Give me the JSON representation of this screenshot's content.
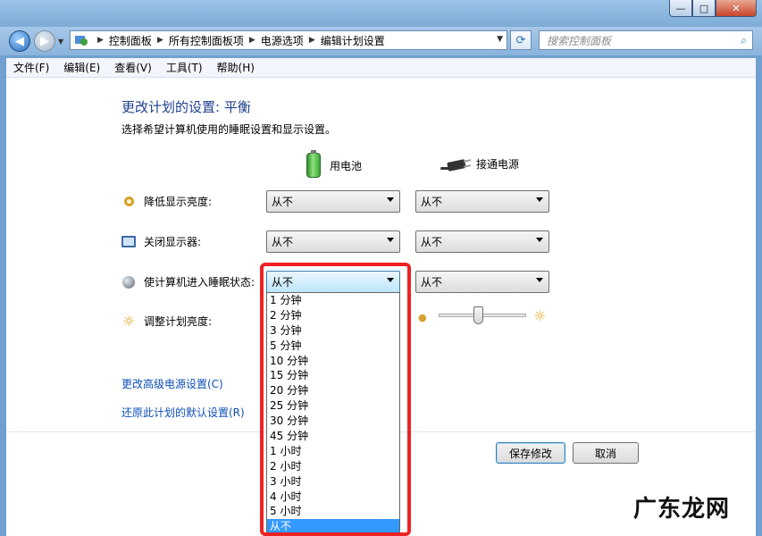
{
  "window": {
    "minimize_glyph": "—",
    "maximize_glyph": "□",
    "close_glyph": "✕"
  },
  "nav": {
    "breadcrumbs": [
      "控制面板",
      "所有控制面板项",
      "电源选项",
      "编辑计划设置"
    ],
    "search_placeholder": "搜索控制面板"
  },
  "menu": [
    "文件(F)",
    "编辑(E)",
    "查看(V)",
    "工具(T)",
    "帮助(H)"
  ],
  "page": {
    "title": "更改计划的设置: 平衡",
    "subtitle": "选择希望计算机使用的睡眠设置和显示设置。",
    "col_battery": "用电池",
    "col_plugged": "接通电源"
  },
  "settings": [
    {
      "label": "降低显示亮度:",
      "battery": "从不",
      "plugged": "从不"
    },
    {
      "label": "关闭显示器:",
      "battery": "从不",
      "plugged": "从不"
    },
    {
      "label": "使计算机进入睡眠状态:",
      "battery": "从不",
      "plugged": "从不"
    },
    {
      "label": "调整计划亮度:"
    }
  ],
  "brightness": {
    "plugged_level": 0.45
  },
  "links": {
    "advanced": "更改高级电源设置(C)",
    "restore": "还原此计划的默认设置(R)"
  },
  "buttons": {
    "save": "保存修改",
    "cancel": "取消"
  },
  "dropdown_options": [
    "1 分钟",
    "2 分钟",
    "3 分钟",
    "5 分钟",
    "10 分钟",
    "15 分钟",
    "20 分钟",
    "25 分钟",
    "30 分钟",
    "45 分钟",
    "1 小时",
    "2 小时",
    "3 小时",
    "4 小时",
    "5 小时",
    "从不"
  ],
  "dropdown_selected_index": 15,
  "watermark": "广东龙网",
  "colors": {
    "highlight": "#ee2222",
    "selected": "#3399ff",
    "link": "#0d4fb8"
  }
}
